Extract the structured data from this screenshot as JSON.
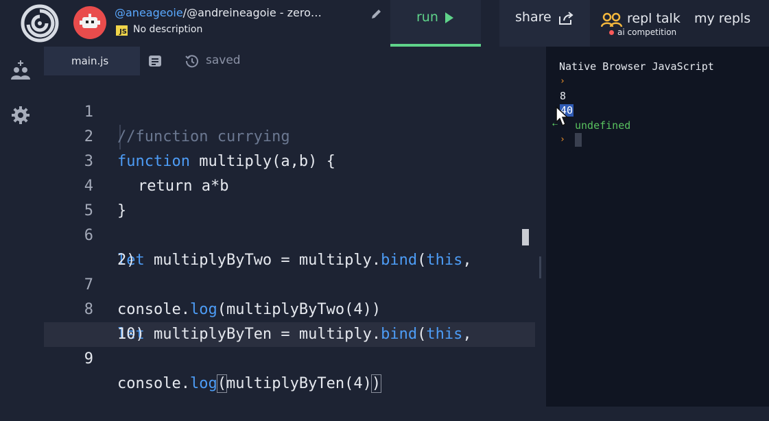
{
  "header": {
    "repl_user": "@aneageoie",
    "repl_sep": "/",
    "repl_name": "@andreineagoie - zero…",
    "lang_badge": "JS",
    "description": "No description",
    "run_label": "run",
    "share_label": "share",
    "talk_label": "repl talk",
    "talk_sub": "ai competition",
    "myrepls_label": "my repls"
  },
  "editor": {
    "file_tab": "main.js",
    "saved_label": "saved",
    "line_numbers": [
      "1",
      "2",
      "3",
      "4",
      "5",
      "6",
      "",
      "7",
      "8",
      "",
      "9"
    ],
    "lines": {
      "l1": "//function currying",
      "l2_kw": "function",
      "l2_rest": " multiply(a,b) {",
      "l3": "return a*b",
      "l4": "}",
      "l6_kw": "let",
      "l6_a": " multiplyByTwo = multiply.",
      "l6_fn": "bind",
      "l6_b": "(",
      "l6_this": "this",
      "l6_c": ",",
      "l6_wrap": "2)",
      "l7_a": "console.",
      "l7_fn": "log",
      "l7_b": "(multiplyByTwo(4))",
      "l8_kw": "let",
      "l8_a": " multiplyByTen = multiply.",
      "l8_fn": "bind",
      "l8_b": "(",
      "l8_this": "this",
      "l8_c": ",",
      "l8_wrap": "10)",
      "l9_a": "console.",
      "l9_fn": "log",
      "l9_open": "(",
      "l9_mid": "multiplyByTen(4)",
      "l9_close": ")"
    }
  },
  "console": {
    "title": "Native Browser JavaScript",
    "prompt": "›",
    "outputs": [
      "8",
      "40",
      "undefined"
    ],
    "result_arrow": "⇠"
  },
  "colors": {
    "accent_green": "#5fd38a",
    "keyword_blue": "#4d9cf5",
    "prompt_orange": "#f0932b"
  },
  "icons": [
    "replit-logo-icon",
    "avatar-robot-icon",
    "pencil-icon",
    "play-icon",
    "share-icon",
    "repl-talk-icon",
    "add-user-icon",
    "gear-icon",
    "notes-icon",
    "history-icon",
    "mouse-pointer-icon"
  ]
}
